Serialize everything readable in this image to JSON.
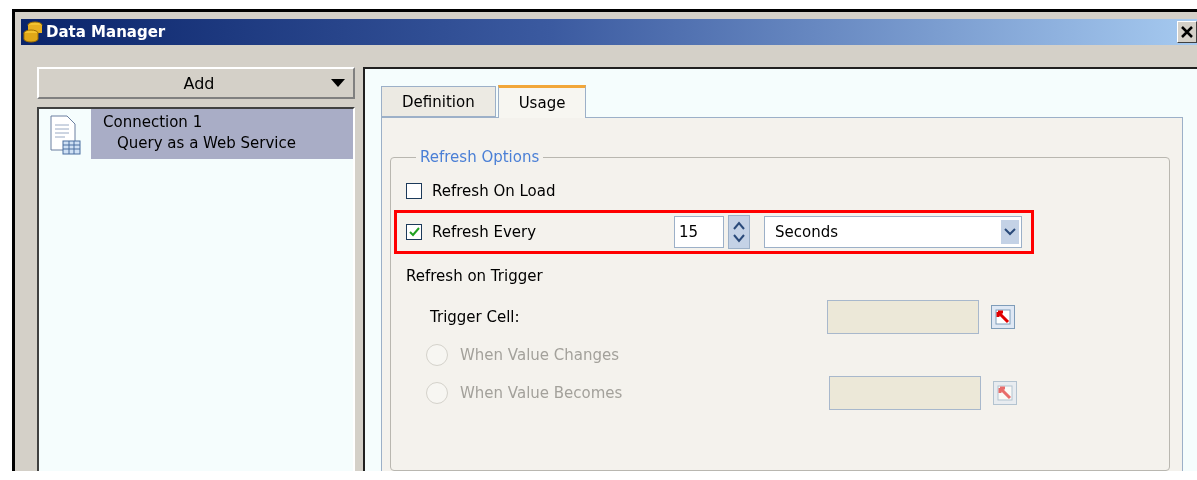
{
  "window": {
    "title": "Data Manager"
  },
  "add_button": {
    "label": "Add"
  },
  "connections": [
    {
      "name": "Connection 1",
      "type": "Query as a Web Service",
      "selected": true
    }
  ],
  "tabs": [
    {
      "label": "Definition",
      "selected": false
    },
    {
      "label": "Usage",
      "selected": true
    }
  ],
  "refresh_options": {
    "title": "Refresh Options",
    "refresh_on_load": {
      "label": "Refresh On Load",
      "checked": false
    },
    "refresh_every": {
      "label": "Refresh Every",
      "checked": true,
      "highlighted": true,
      "value": "15",
      "unit": "Seconds"
    },
    "trigger_heading": "Refresh on Trigger",
    "trigger_cell": {
      "label": "Trigger Cell:"
    },
    "radios": [
      {
        "label": "When Value Changes",
        "selected": false,
        "disabled": true,
        "kind": "plain"
      },
      {
        "label": "When Value Becomes",
        "selected": false,
        "disabled": true,
        "kind": "with_field"
      }
    ]
  }
}
